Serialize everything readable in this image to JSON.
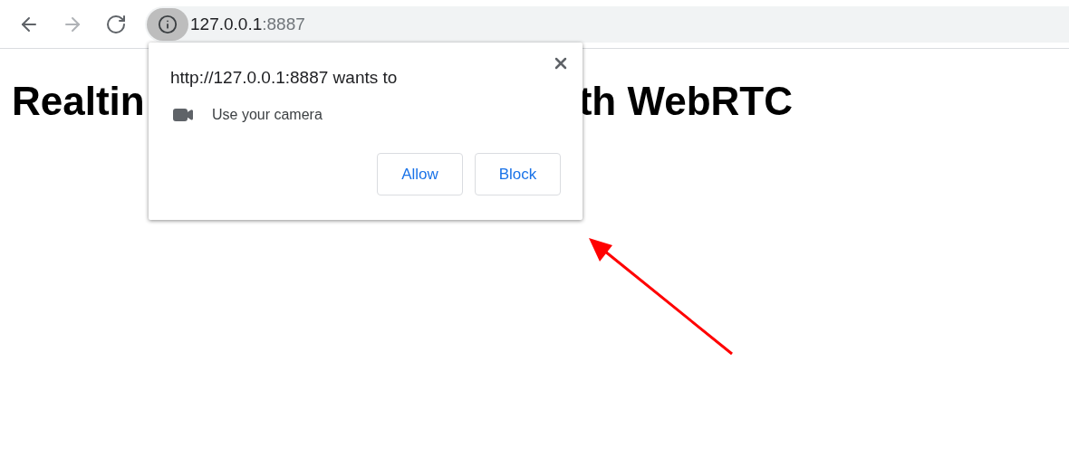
{
  "toolbar": {
    "nav_buttons": [
      {
        "kind": "back",
        "disabled": false
      },
      {
        "kind": "forward",
        "disabled": true
      },
      {
        "kind": "reload",
        "disabled": false
      }
    ],
    "address": {
      "host": "127.0.0.1",
      "port": ":8887"
    }
  },
  "page": {
    "heading_parts": [
      "Realtin",
      "th WebRTC"
    ]
  },
  "permission_popup": {
    "title": "http://127.0.0.1:8887 wants to",
    "permission": "Use your camera",
    "buttons": [
      "Allow",
      "Block"
    ]
  }
}
